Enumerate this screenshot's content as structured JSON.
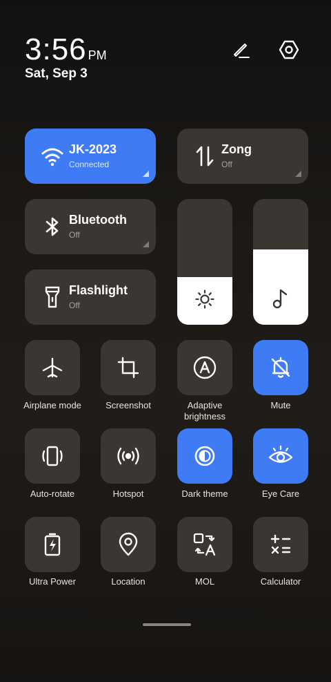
{
  "header": {
    "time": "3:56",
    "ampm": "PM",
    "date": "Sat, Sep 3"
  },
  "tiles": {
    "wifi": {
      "name": "JK-2023",
      "status": "Connected",
      "icon": "wifi-icon",
      "active": true
    },
    "mobile_data": {
      "name": "Zong",
      "status": "Off",
      "icon": "up-down-arrows-icon",
      "active": false
    },
    "bluetooth": {
      "name": "Bluetooth",
      "status": "Off",
      "icon": "bluetooth-icon",
      "active": false
    },
    "flashlight": {
      "name": "Flashlight",
      "status": "Off",
      "icon": "flashlight-icon",
      "active": false
    }
  },
  "sliders": {
    "brightness": {
      "level_percent": 38,
      "icon": "sun-icon"
    },
    "volume": {
      "level_percent": 60,
      "icon": "music-note-icon"
    }
  },
  "toggles": [
    {
      "label": "Airplane mode",
      "icon": "airplane-icon",
      "active": false
    },
    {
      "label": "Screenshot",
      "icon": "crop-icon",
      "active": false
    },
    {
      "label": "Adaptive brightness",
      "label_line2": "brightness",
      "icon": "auto-brightness-icon",
      "active": false
    },
    {
      "label": "Mute",
      "icon": "bell-off-icon",
      "active": true
    },
    {
      "label": "Auto-rotate",
      "icon": "rotate-icon",
      "active": false
    },
    {
      "label": "Hotspot",
      "icon": "hotspot-icon",
      "active": false
    },
    {
      "label": "Dark theme",
      "icon": "dark-theme-icon",
      "active": true
    },
    {
      "label": "Eye Care",
      "icon": "eye-icon",
      "active": true
    },
    {
      "label": "Ultra Power",
      "icon": "battery-bolt-icon",
      "active": false
    },
    {
      "label": "Location",
      "icon": "location-pin-icon",
      "active": false
    },
    {
      "label": "MOL",
      "icon": "translate-icon",
      "active": false
    },
    {
      "label": "Calculator",
      "icon": "calculator-icon",
      "active": false
    }
  ],
  "labels_split": {
    "adaptive_line1": "Adaptive",
    "adaptive_line2": "brightness"
  },
  "colors": {
    "accent": "#3f7bf4",
    "tile": "#3a3632",
    "background": "#1c1916"
  }
}
